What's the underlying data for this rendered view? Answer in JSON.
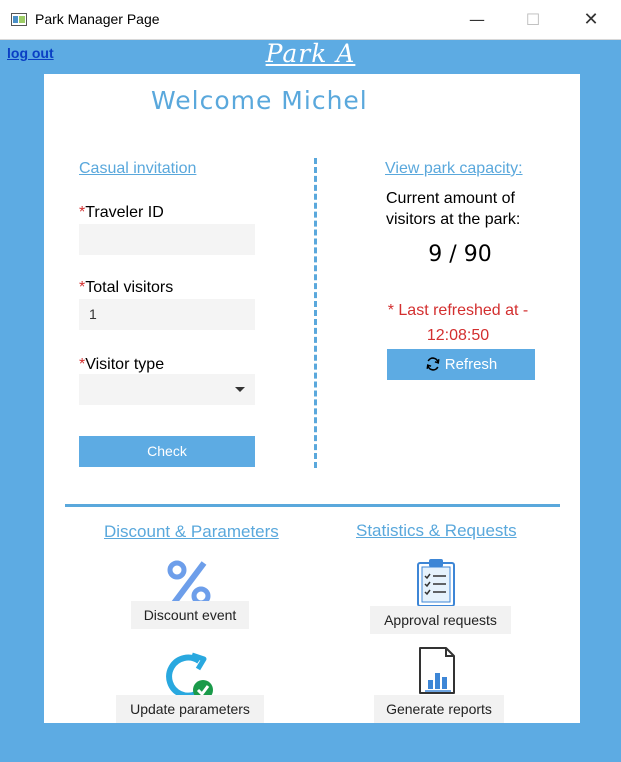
{
  "window": {
    "title": "Park Manager Page",
    "minimize_glyph": "—",
    "maximize_glyph": "☐",
    "close_glyph": "✕"
  },
  "header": {
    "logout_label": "log out",
    "park_name": "Park A"
  },
  "welcome": "Welcome Michel",
  "casual_invitation": {
    "heading": "Casual invitation",
    "required_mark": "*",
    "traveler_id_label": "Traveler ID",
    "traveler_id_value": "",
    "total_visitors_label": "Total visitors",
    "total_visitors_value": "1",
    "visitor_type_label": "Visitor type",
    "visitor_type_value": "",
    "check_button": "Check"
  },
  "capacity": {
    "heading": "View park capacity:",
    "description_line1": "Current amount of",
    "description_line2": "visitors at the park:",
    "value": "9 / 90",
    "refresh_line1": "* Last refreshed at -",
    "refresh_line2": "12:08:50",
    "refresh_button": "Refresh"
  },
  "discount": {
    "heading": "Discount & Parameters",
    "discount_event": "Discount event",
    "update_parameters": "Update parameters"
  },
  "statistics": {
    "heading": "Statistics & Requests",
    "approval_requests": "Approval requests",
    "generate_reports": "Generate reports"
  },
  "colors": {
    "frame_blue": "#5dabe3",
    "accent_blue": "#5aa8dc",
    "required_red": "#d32f2f",
    "logout_link": "#0a3fc4",
    "success_green": "#1a9a4a"
  },
  "icons": {
    "app": "app-window-icon",
    "refresh": "refresh-icon",
    "discount": "percent-icon",
    "update": "update-parameters-icon",
    "approval": "clipboard-checklist-icon",
    "reports": "report-chart-icon",
    "dropdown": "chevron-down-icon"
  }
}
